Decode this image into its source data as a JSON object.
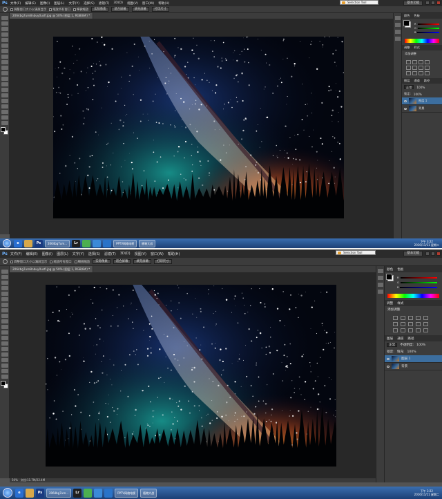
{
  "menu": {
    "items_top": [
      "文件(F)",
      "编辑(E)",
      "图像(I)",
      "图层(L)",
      "文字(Y)",
      "选择(S)",
      "滤镜(T)",
      "3D(D)",
      "视图(V)",
      "窗口(W)",
      "帮助(H)"
    ],
    "items_bottom": [
      "文件(F)",
      "编辑(E)",
      "图像(I)",
      "图层(L)",
      "文字(Y)",
      "选择(S)",
      "滤镜(T)",
      "3D(D)",
      "视图(V)",
      "窗口(W)",
      "帮助(H)"
    ],
    "workspace": "基本功能"
  },
  "options_bar": {
    "resize_windows": "调整窗口大小以满屏显示",
    "zoom_all": "缩放所有窗口",
    "scrubby_zoom": "细微缩放",
    "actual_pixels": "实际像素",
    "fit_screen": "适合屏幕",
    "fill_screen": "填充屏幕",
    "print_size": "打印尺寸"
  },
  "document": {
    "tab_title": "2064bg7um8nbuy0usfi.jpg @ 50% (图层 1, RGB/8#) *",
    "zoom": "50%",
    "doc_size": "文档:11.7M/22.4M"
  },
  "panels": {
    "color_tabs": [
      "颜色",
      "色板"
    ],
    "color_labels": [
      "R",
      "G",
      "B"
    ],
    "adjust_tabs": [
      "调整",
      "样式"
    ],
    "adjust_title": "添加调整",
    "layers_tabs": [
      "图层",
      "通道",
      "路径"
    ],
    "blend_mode": "正常",
    "opacity_label": "不透明度:",
    "opacity": "100%",
    "lock_label": "锁定:",
    "fill_label": "填充:",
    "fill": "100%",
    "layers": [
      {
        "name": "图层 1",
        "selected": true
      },
      {
        "name": "背景",
        "selected": false
      }
    ]
  },
  "float_window": {
    "title": "Selection Tool"
  },
  "taskbar": {
    "apps": [
      "2064bg7um...",
      "PPTV网络电视",
      "植物大战"
    ],
    "time": "下午 3:22",
    "date": "2016/11/11 星期二"
  },
  "colors": {
    "ps_bg": "#535353",
    "panel_bg": "#3c3c3c",
    "selected_layer": "#3c6e9f"
  }
}
